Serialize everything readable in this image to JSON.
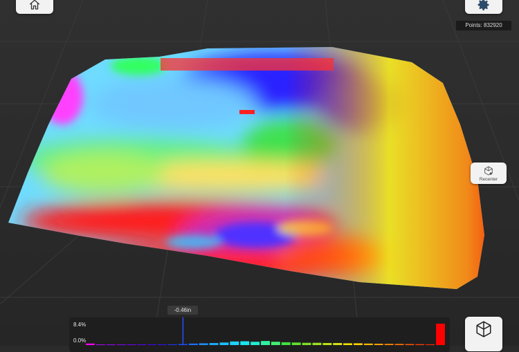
{
  "points_label": "Points: 832920",
  "recenter_label": "Recenter",
  "marker_value": "-0.46in",
  "histogram": {
    "max_label": "8.4%",
    "min_label": "0.0%",
    "bars": [
      {
        "value": 0.6,
        "color": "#ff00ff"
      },
      {
        "value": 0.2,
        "color": "#b000ff"
      },
      {
        "value": 0.2,
        "color": "#9a00ff"
      },
      {
        "value": 0.2,
        "color": "#8400ff"
      },
      {
        "value": 0.2,
        "color": "#6e00ff"
      },
      {
        "value": 0.2,
        "color": "#5a00ff"
      },
      {
        "value": 0.25,
        "color": "#4400ff"
      },
      {
        "value": 0.25,
        "color": "#3010ff"
      },
      {
        "value": 0.3,
        "color": "#2030ff"
      },
      {
        "value": 0.4,
        "color": "#1a50ff"
      },
      {
        "value": 0.6,
        "color": "#1a70ff"
      },
      {
        "value": 0.7,
        "color": "#1a90ff"
      },
      {
        "value": 0.8,
        "color": "#1aaaff"
      },
      {
        "value": 1.0,
        "color": "#1ac0ff"
      },
      {
        "value": 1.4,
        "color": "#1ad4ff"
      },
      {
        "value": 1.5,
        "color": "#1ae4f0"
      },
      {
        "value": 1.3,
        "color": "#20ecd0"
      },
      {
        "value": 1.6,
        "color": "#30f0a0"
      },
      {
        "value": 1.3,
        "color": "#40f070"
      },
      {
        "value": 1.1,
        "color": "#40e040"
      },
      {
        "value": 1.0,
        "color": "#60e030"
      },
      {
        "value": 0.9,
        "color": "#80e020"
      },
      {
        "value": 0.9,
        "color": "#a0e020"
      },
      {
        "value": 0.8,
        "color": "#c0e010"
      },
      {
        "value": 0.8,
        "color": "#d8e010"
      },
      {
        "value": 0.7,
        "color": "#f0e000"
      },
      {
        "value": 0.7,
        "color": "#ffd000"
      },
      {
        "value": 0.6,
        "color": "#ffb800"
      },
      {
        "value": 0.55,
        "color": "#ffa000"
      },
      {
        "value": 0.5,
        "color": "#ff8800"
      },
      {
        "value": 0.45,
        "color": "#ff7000"
      },
      {
        "value": 0.4,
        "color": "#ff5800"
      },
      {
        "value": 0.35,
        "color": "#ff4000"
      },
      {
        "value": 0.3,
        "color": "#ff2800"
      },
      {
        "value": 8.4,
        "color": "#ff0000"
      }
    ],
    "range_max": 8.4,
    "marker_bar_index": 9
  }
}
